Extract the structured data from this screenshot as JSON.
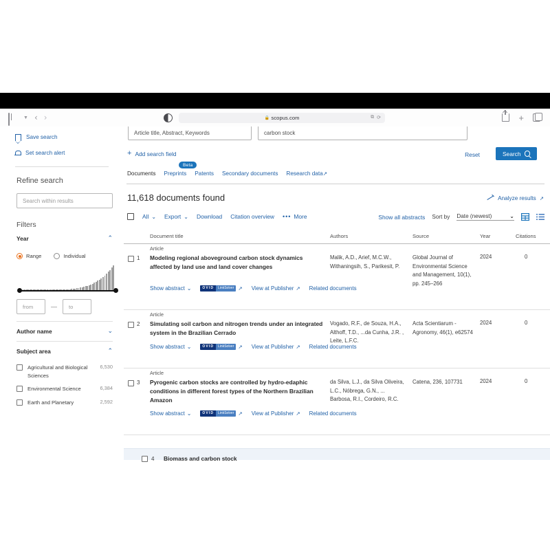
{
  "browser": {
    "url": "scopus.com",
    "lock_icon": "lock-icon",
    "sidebar_icon": "sidebar-toggle-icon",
    "back_icon": "back-arrow-icon",
    "forward_icon": "forward-arrow-icon",
    "reader_icon": "reader-mode-icon",
    "extensions_icon": "extensions-icon",
    "reload_icon": "reload-icon",
    "share_icon": "share-icon",
    "newtab_icon": "new-tab-icon",
    "tabs_icon": "tab-overview-icon"
  },
  "rail": {
    "save_search": "Save search",
    "set_alert": "Set search alert",
    "refine_title": "Refine search",
    "search_within_placeholder": "Search within results",
    "filters_title": "Filters",
    "facets": [
      {
        "name": "Year",
        "expanded": true
      },
      {
        "name": "Author name",
        "expanded": false
      },
      {
        "name": "Subject area",
        "expanded": true
      }
    ],
    "year": {
      "mode_range": "Range",
      "mode_individual": "Individual",
      "selected_mode": "Range",
      "from_placeholder": "from",
      "to_placeholder": "to",
      "dash": "—"
    },
    "subject_area": [
      {
        "label": "Agricultural and Biological Sciences",
        "count": "6,530"
      },
      {
        "label": "Environmental Science",
        "count": "6,384"
      },
      {
        "label": "Earth and Planetary",
        "count": "2,592"
      }
    ]
  },
  "search": {
    "field_label": "Article title, Abstract, Keywords",
    "query_value": "carbon stock",
    "add_field": "Add search field",
    "reset": "Reset",
    "search_button": "Search"
  },
  "tabs": [
    {
      "label": "Documents",
      "active": true,
      "badge": ""
    },
    {
      "label": "Preprints",
      "active": false,
      "badge": "Beta"
    },
    {
      "label": "Patents",
      "active": false,
      "badge": ""
    },
    {
      "label": "Secondary documents",
      "active": false,
      "badge": ""
    },
    {
      "label": "Research data",
      "active": false,
      "badge": "",
      "external": true
    }
  ],
  "results": {
    "found_text": "11,618 documents found",
    "analyze": "Analyze results",
    "actions": {
      "all": "All",
      "export": "Export",
      "download": "Download",
      "citation_overview": "Citation overview",
      "more": "More",
      "show_all_abstracts": "Show all abstracts",
      "sort_by_label": "Sort by",
      "sort_value": "Date (newest)",
      "grid_view_icon": "grid-view-icon",
      "list_view_icon": "list-view-icon"
    },
    "columns": {
      "title": "Document title",
      "authors": "Authors",
      "source": "Source",
      "year": "Year",
      "citations": "Citations"
    },
    "row_links": {
      "show_abstract": "Show abstract",
      "ovid": "OVID",
      "linksolver": "LinkSolver",
      "view_at_publisher": "View at Publisher",
      "related_documents": "Related documents"
    },
    "items": [
      {
        "n": "1",
        "kind": "Article",
        "title": "Modeling regional aboveground carbon stock dynamics affected by land use and land cover changes",
        "authors": "Malik, A.D., Arief, M.C.W., Withaningsih, S., Parikesit, P.",
        "source": "Global Journal of Environmental Science and Management, 10(1), pp. 245–266",
        "year": "2024",
        "citations": "0"
      },
      {
        "n": "2",
        "kind": "Article",
        "title": "Simulating soil carbon and nitrogen trends under an integrated system in the Brazilian Cerrado",
        "authors": "Vogado, R.F., de Souza, H.A., Althoff, T.D., ...da Cunha, J.R. , Leite, L.F.C.",
        "source": "Acta Scientiarum - Agronomy, 46(1), e62574",
        "year": "2024",
        "citations": "0"
      },
      {
        "n": "3",
        "kind": "Article",
        "title": "Pyrogenic carbon stocks are controlled by hydro-edaphic conditions in different forest types of the Northern Brazilian Amazon",
        "authors": "da Silva, L.J., da Silva Oliveira, L.C., Nóbrega, G.N., ... Barbosa, R.I., Cordeiro, R.C.",
        "source": "Catena, 236, 107731",
        "year": "2024",
        "citations": "0"
      }
    ],
    "partial_row": {
      "n": "4",
      "title": "Biomass and carbon stock"
    }
  },
  "colors": {
    "link_blue": "#2161a7",
    "button_blue": "#1b74bb",
    "accent_orange": "#e9711c",
    "ovid_navy": "#10347a",
    "highlight_row": "#eef3f9"
  }
}
